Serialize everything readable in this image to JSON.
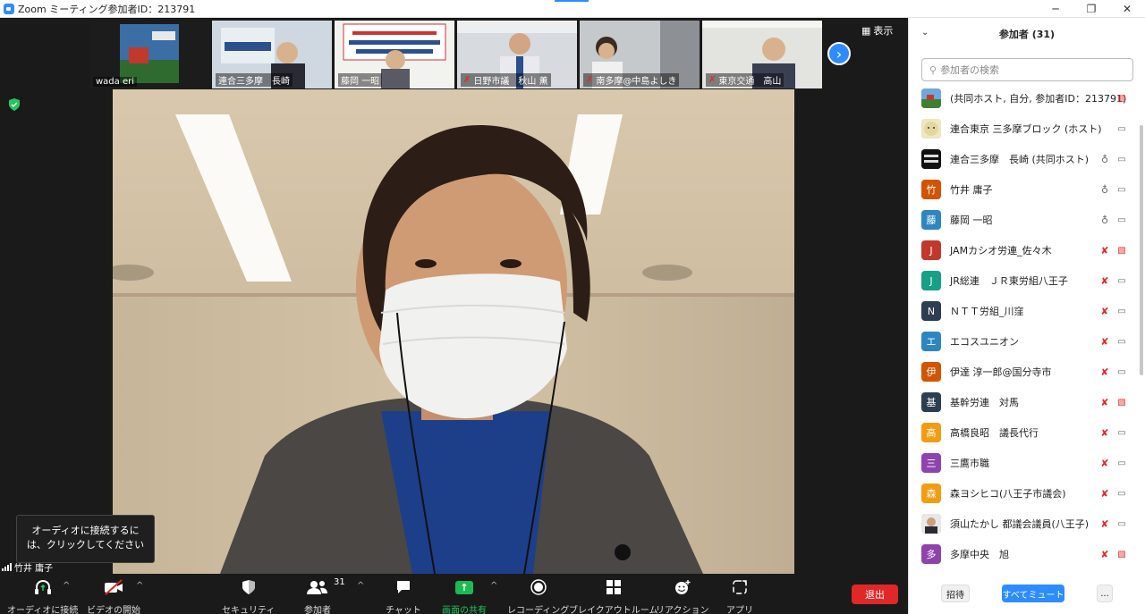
{
  "window": {
    "title": "Zoom ミーティング参加者ID：213791",
    "minimize": "─",
    "maximize": "❐",
    "close": "✕"
  },
  "thumbnails": [
    {
      "name": "wada eri",
      "muted": false
    },
    {
      "name": "連合三多摩　長崎",
      "muted": false
    },
    {
      "name": "藤岡 一昭",
      "muted": false
    },
    {
      "name": "日野市議　秋山 薫",
      "muted": true
    },
    {
      "name": "南多摩@中島よしき",
      "muted": true
    },
    {
      "name": "東京交通　高山",
      "muted": true
    }
  ],
  "view_button": "表示",
  "audio_popup": "オーディオに接続するには、クリックしてください",
  "active_speaker": "竹井 庸子",
  "toolbar": {
    "audio": "オーディオに接続",
    "video": "ビデオの開始",
    "security": "セキュリティ",
    "participants": "参加者",
    "participant_count": "31",
    "chat": "チャット",
    "share": "画面の共有",
    "record": "レコーディング",
    "breakout": "ブレイクアウトルーム",
    "reactions": "リアクション",
    "apps": "アプリ",
    "leave": "退出"
  },
  "panel": {
    "title": "参加者 (31)",
    "search_placeholder": "参加者の検索",
    "invite": "招待",
    "mute_all": "すべてミュート",
    "more": "..."
  },
  "participants": [
    {
      "name": "(共同ホスト, 自分, 参加者ID：213791)",
      "avatar": "",
      "color": "#5b8f3a",
      "img": "photo1",
      "mic": "none",
      "cam": "off"
    },
    {
      "name": "連合東京 三多摩ブロック (ホスト)",
      "avatar": "",
      "color": "#d9cfa0",
      "img": "photo2",
      "mic": "none",
      "cam": "on"
    },
    {
      "name": "連合三多摩　長崎 (共同ホスト)",
      "avatar": "",
      "color": "#222222",
      "img": "photo3",
      "mic": "on",
      "cam": "on"
    },
    {
      "name": "竹井 庸子",
      "avatar": "竹",
      "color": "#d35400",
      "mic": "on",
      "cam": "on"
    },
    {
      "name": "藤岡 一昭",
      "avatar": "藤",
      "color": "#2e86c1",
      "mic": "on",
      "cam": "on"
    },
    {
      "name": "JAMカシオ労連_佐々木",
      "avatar": "J",
      "color": "#c0392b",
      "mic": "muted",
      "cam": "off"
    },
    {
      "name": "JR総連　ＪＲ東労組八王子",
      "avatar": "J",
      "color": "#16a085",
      "mic": "muted",
      "cam": "on"
    },
    {
      "name": "ＮＴＴ労組_川窪",
      "avatar": "N",
      "color": "#2c3e50",
      "mic": "muted",
      "cam": "on"
    },
    {
      "name": "エコスユニオン",
      "avatar": "エ",
      "color": "#2e86c1",
      "mic": "muted",
      "cam": "on"
    },
    {
      "name": "伊達 淳一郎@国分寺市",
      "avatar": "伊",
      "color": "#d35400",
      "mic": "muted",
      "cam": "on"
    },
    {
      "name": "基幹労連　対馬",
      "avatar": "基",
      "color": "#2c3e50",
      "mic": "muted",
      "cam": "off"
    },
    {
      "name": "高橋良昭　議長代行",
      "avatar": "高",
      "color": "#f39c12",
      "mic": "muted",
      "cam": "on"
    },
    {
      "name": "三鷹市職",
      "avatar": "三",
      "color": "#8e44ad",
      "mic": "muted",
      "cam": "on"
    },
    {
      "name": "森ヨシヒコ(八王子市議会)",
      "avatar": "森",
      "color": "#f39c12",
      "mic": "muted",
      "cam": "on"
    },
    {
      "name": "須山たかし 都議会議員(八王子)",
      "avatar": "",
      "color": "#c9a27c",
      "img": "photo4",
      "mic": "muted",
      "cam": "on"
    },
    {
      "name": "多摩中央　旭",
      "avatar": "多",
      "color": "#8e44ad",
      "mic": "muted",
      "cam": "off"
    }
  ]
}
